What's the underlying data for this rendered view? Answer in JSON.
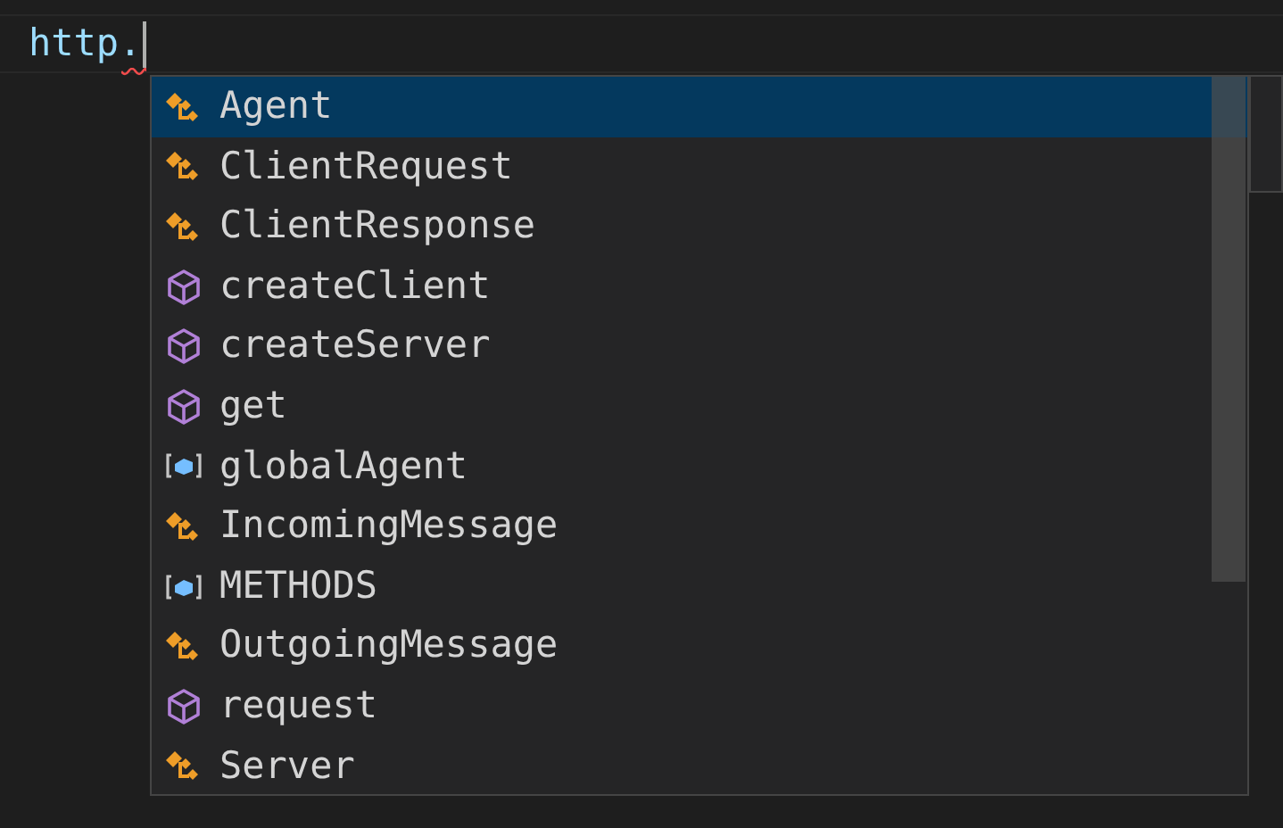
{
  "editor": {
    "line_text": "http.",
    "error_squiggle": true
  },
  "suggestions": [
    {
      "label": "Agent",
      "kind": "class",
      "selected": true
    },
    {
      "label": "ClientRequest",
      "kind": "class",
      "selected": false
    },
    {
      "label": "ClientResponse",
      "kind": "class",
      "selected": false
    },
    {
      "label": "createClient",
      "kind": "method",
      "selected": false
    },
    {
      "label": "createServer",
      "kind": "method",
      "selected": false
    },
    {
      "label": "get",
      "kind": "method",
      "selected": false
    },
    {
      "label": "globalAgent",
      "kind": "variable",
      "selected": false
    },
    {
      "label": "IncomingMessage",
      "kind": "class",
      "selected": false
    },
    {
      "label": "METHODS",
      "kind": "variable",
      "selected": false
    },
    {
      "label": "OutgoingMessage",
      "kind": "class",
      "selected": false
    },
    {
      "label": "request",
      "kind": "method",
      "selected": false
    },
    {
      "label": "Server",
      "kind": "class",
      "selected": false
    }
  ]
}
